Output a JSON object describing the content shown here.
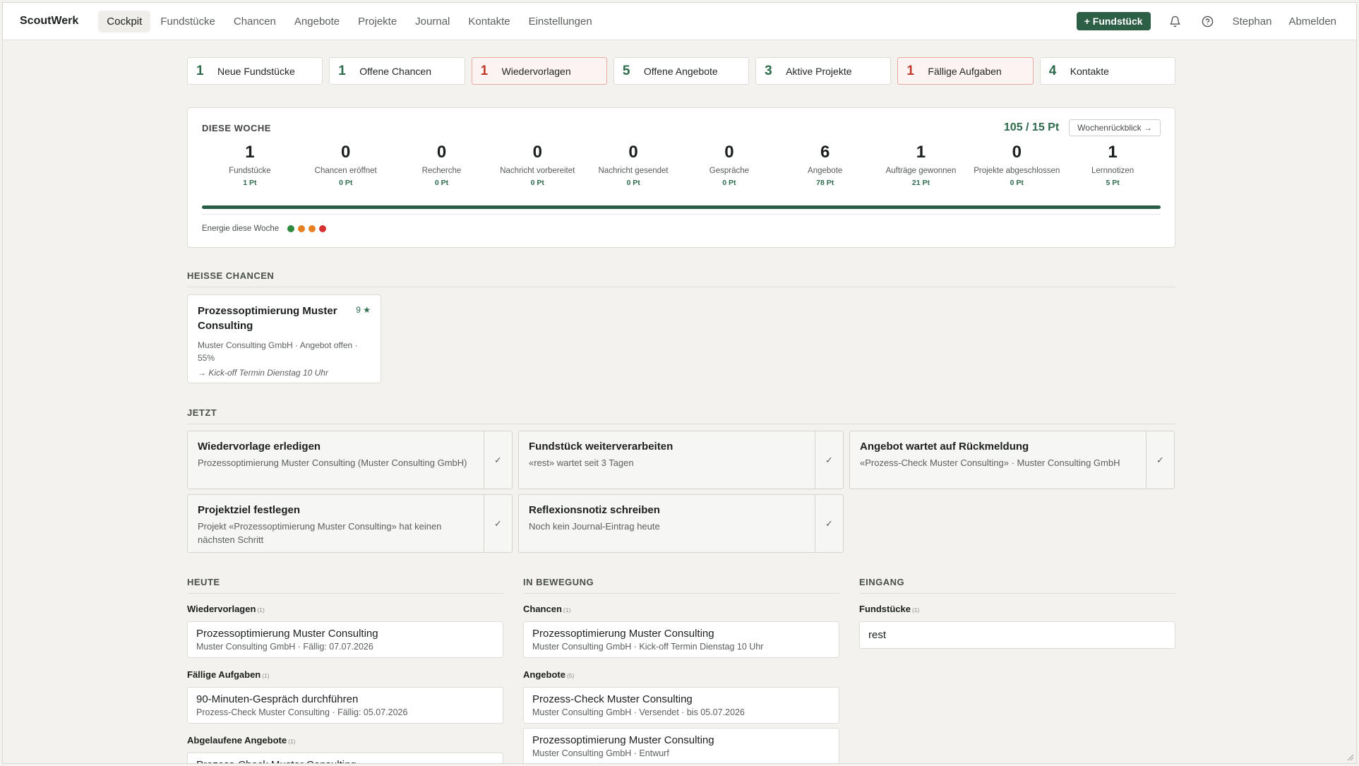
{
  "nav": {
    "brand": "ScoutWerk",
    "links": [
      "Cockpit",
      "Fundstücke",
      "Chancen",
      "Angebote",
      "Projekte",
      "Journal",
      "Kontakte",
      "Einstellungen"
    ],
    "add_button": "+ Fundstück",
    "user": "Stephan",
    "logout": "Abmelden"
  },
  "tiles": [
    {
      "count": "1",
      "label": "Neue Fundstücke"
    },
    {
      "count": "1",
      "label": "Offene Chancen"
    },
    {
      "count": "1",
      "label": "Wiedervorlagen"
    },
    {
      "count": "5",
      "label": "Offene Angebote"
    },
    {
      "count": "3",
      "label": "Aktive Projekte"
    },
    {
      "count": "1",
      "label": "Fällige Aufgaben"
    },
    {
      "count": "4",
      "label": "Kontakte"
    }
  ],
  "week": {
    "title": "DIESE WOCHE",
    "points": "105 / 15 Pt",
    "review_button": "Wochenrückblick →",
    "progress": 1.0,
    "stats": [
      {
        "value": "1",
        "label": "Fundstücke",
        "points": "1 Pt"
      },
      {
        "value": "0",
        "label": "Chancen eröffnet",
        "points": "0 Pt"
      },
      {
        "value": "0",
        "label": "Recherche",
        "points": "0 Pt"
      },
      {
        "value": "0",
        "label": "Nachricht vorbereitet",
        "points": "0 Pt"
      },
      {
        "value": "0",
        "label": "Nachricht gesendet",
        "points": "0 Pt"
      },
      {
        "value": "0",
        "label": "Gespräche",
        "points": "0 Pt"
      },
      {
        "value": "6",
        "label": "Angebote",
        "points": "78 Pt"
      },
      {
        "value": "1",
        "label": "Aufträge gewonnen",
        "points": "21 Pt"
      },
      {
        "value": "0",
        "label": "Projekte abgeschlossen",
        "points": "0 Pt"
      },
      {
        "value": "1",
        "label": "Lernnotizen",
        "points": "5 Pt"
      }
    ],
    "energy_label": "Energie diese Woche",
    "energy_colors": [
      "#2e8b3e",
      "#e67e22",
      "#e67e22",
      "#d63031"
    ]
  },
  "hot": {
    "heading": "HEISSE CHANCEN",
    "card": {
      "title": "Prozessoptimierung Muster Consulting",
      "score": "9 ★",
      "meta": "Muster Consulting GmbH · Angebot offen · 55%",
      "next": "→ Kick-off Termin Dienstag 10 Uhr"
    }
  },
  "now": {
    "heading": "JETZT",
    "cards": [
      {
        "title": "Wiedervorlage erledigen",
        "desc": "Prozessoptimierung Muster Consulting (Muster Consulting GmbH)"
      },
      {
        "title": "Fundstück weiterverarbeiten",
        "desc": "«rest» wartet seit 3 Tagen"
      },
      {
        "title": "Angebot wartet auf Rückmeldung",
        "desc": "«Prozess-Check Muster Consulting» · Muster Consulting GmbH"
      },
      {
        "title": "Projektziel festlegen",
        "desc": "Projekt «Prozessoptimierung Muster Consulting» hat keinen nächsten Schritt"
      },
      {
        "title": "Reflexionsnotiz schreiben",
        "desc": "Noch kein Journal-Eintrag heute"
      }
    ],
    "check": "✓"
  },
  "today": {
    "heading": "HEUTE",
    "groups": [
      {
        "title": "Wiedervorlagen",
        "count": "(1)",
        "items": [
          {
            "title": "Prozessoptimierung Muster Consulting",
            "sub": "Muster Consulting GmbH · Fällig: 07.07.2026"
          }
        ]
      },
      {
        "title": "Fällige Aufgaben",
        "count": "(1)",
        "items": [
          {
            "title": "90-Minuten-Gespräch durchführen",
            "sub": "Prozess-Check Muster Consulting · Fällig: 05.07.2026"
          }
        ]
      },
      {
        "title": "Abgelaufene Angebote",
        "count": "(1)",
        "items": [
          {
            "title": "Prozess-Check Muster Consulting",
            "sub": ""
          }
        ]
      }
    ]
  },
  "moving": {
    "heading": "IN BEWEGUNG",
    "groups": [
      {
        "title": "Chancen",
        "count": "(1)",
        "items": [
          {
            "title": "Prozessoptimierung Muster Consulting",
            "sub": "Muster Consulting GmbH · Kick-off Termin Dienstag 10 Uhr"
          }
        ]
      },
      {
        "title": "Angebote",
        "count": "(5)",
        "items": [
          {
            "title": "Prozess-Check Muster Consulting",
            "sub": "Muster Consulting GmbH · Versendet · bis 05.07.2026"
          },
          {
            "title": "Prozessoptimierung Muster Consulting",
            "sub": "Muster Consulting GmbH · Entwurf"
          }
        ]
      }
    ]
  },
  "inbox": {
    "heading": "EINGANG",
    "groups": [
      {
        "title": "Fundstücke",
        "count": "(1)",
        "items": [
          {
            "title": "rest"
          }
        ]
      }
    ]
  }
}
